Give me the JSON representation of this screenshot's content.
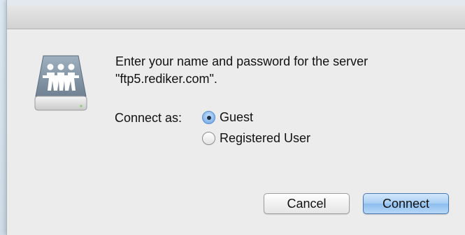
{
  "dialog": {
    "message_line1": "Enter your name and password for the server",
    "message_line2": "\"ftp5.rediker.com\".",
    "icon": "shared-server-icon"
  },
  "connect_as": {
    "label": "Connect as:",
    "options": [
      {
        "label": "Guest",
        "selected": true
      },
      {
        "label": "Registered User",
        "selected": false
      }
    ]
  },
  "buttons": {
    "cancel_label": "Cancel",
    "connect_label": "Connect"
  },
  "colors": {
    "dialog_bg": "#ececec",
    "default_button": "#8dbdef",
    "radio_selected": "#6aa1e3"
  }
}
